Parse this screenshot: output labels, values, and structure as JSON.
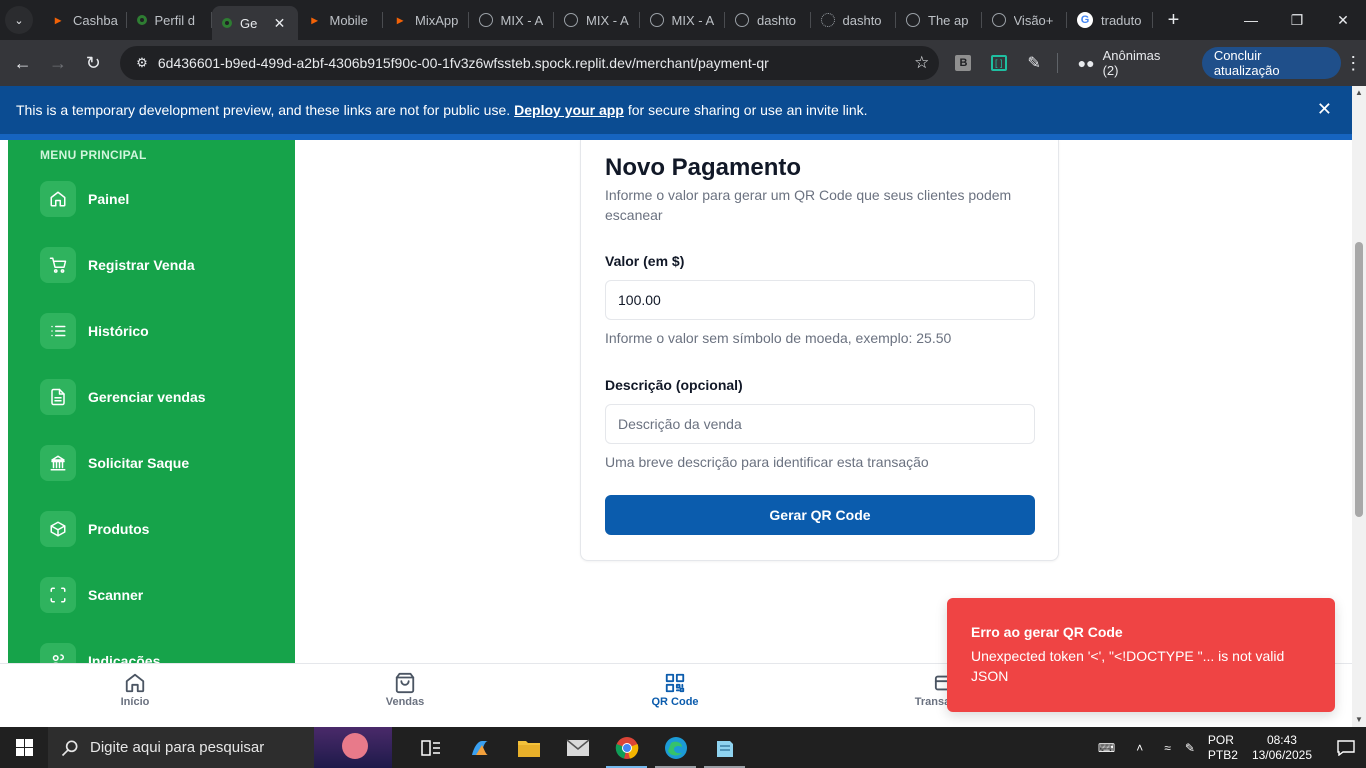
{
  "browser": {
    "tabs": [
      {
        "label": "Cashba",
        "icon": "replit-icon",
        "active": false
      },
      {
        "label": "Perfil d",
        "icon": "replit-run-icon",
        "active": false
      },
      {
        "label": "Ge",
        "icon": "replit-run-icon",
        "active": true
      },
      {
        "label": "Mobile",
        "icon": "replit-icon",
        "active": false
      },
      {
        "label": "MixApp",
        "icon": "replit-icon",
        "active": false
      },
      {
        "label": "MIX - A",
        "icon": "globe-icon",
        "active": false
      },
      {
        "label": "MIX - A",
        "icon": "globe-icon",
        "active": false
      },
      {
        "label": "MIX - A",
        "icon": "globe-icon",
        "active": false
      },
      {
        "label": "dashto",
        "icon": "globe-icon",
        "active": false
      },
      {
        "label": "dashto",
        "icon": "openai-icon",
        "active": false
      },
      {
        "label": "The ap",
        "icon": "globe-icon",
        "active": false
      },
      {
        "label": "Visão+",
        "icon": "globe-icon",
        "active": false
      },
      {
        "label": "traduto",
        "icon": "google-icon",
        "active": false
      }
    ],
    "url": "6d436601-b9ed-499d-a2bf-4306b915f90c-00-1fv3z6wfssteb.spock.replit.dev/merchant/payment-qr",
    "profile_label": "Anônimas (2)",
    "update_label": "Concluir atualização",
    "extension_b_label": "B"
  },
  "dev_banner": {
    "text_before": "This is a temporary development preview, and these links are not for public use.",
    "link": "Deploy your app",
    "text_after": "for secure sharing or use an invite link."
  },
  "sidebar": {
    "title": "MENU PRINCIPAL",
    "items": [
      {
        "label": "Painel",
        "icon": "home-icon"
      },
      {
        "label": "Registrar Venda",
        "icon": "cart-icon"
      },
      {
        "label": "Histórico",
        "icon": "list-icon"
      },
      {
        "label": "Gerenciar vendas",
        "icon": "document-icon"
      },
      {
        "label": "Solicitar Saque",
        "icon": "bank-icon"
      },
      {
        "label": "Produtos",
        "icon": "box-icon"
      },
      {
        "label": "Scanner",
        "icon": "scan-icon"
      },
      {
        "label": "Indicações",
        "icon": "users-icon"
      }
    ]
  },
  "form": {
    "title": "Novo Pagamento",
    "subtitle": "Informe o valor para gerar um QR Code que seus clientes podem escanear",
    "amount_label": "Valor (em $)",
    "amount_value": "100.00",
    "amount_help": "Informe o valor sem símbolo de moeda, exemplo: 25.50",
    "description_label": "Descrição (opcional)",
    "description_placeholder": "Descrição da venda",
    "description_help": "Uma breve descrição para identificar esta transação",
    "submit_label": "Gerar QR Code"
  },
  "bottom_nav": {
    "items": [
      {
        "label": "Início",
        "icon": "home-icon",
        "active": false
      },
      {
        "label": "Vendas",
        "icon": "bag-icon",
        "active": false
      },
      {
        "label": "QR Code",
        "icon": "qr-icon",
        "active": true
      },
      {
        "label": "Transações",
        "icon": "card-icon",
        "active": false
      }
    ]
  },
  "toast": {
    "title": "Erro ao gerar QR Code",
    "message": "Unexpected token '<', \"<!DOCTYPE \"... is not valid JSON"
  },
  "taskbar": {
    "search_placeholder": "Digite aqui para pesquisar",
    "lang_top": "POR",
    "lang_bottom": "PTB2",
    "time": "08:43",
    "date": "13/06/2025"
  },
  "colors": {
    "sidebar_bg": "#16a34a",
    "primary": "#0b5cad",
    "toast_bg": "#ef4444",
    "banner_bg": "#0b4c92"
  }
}
